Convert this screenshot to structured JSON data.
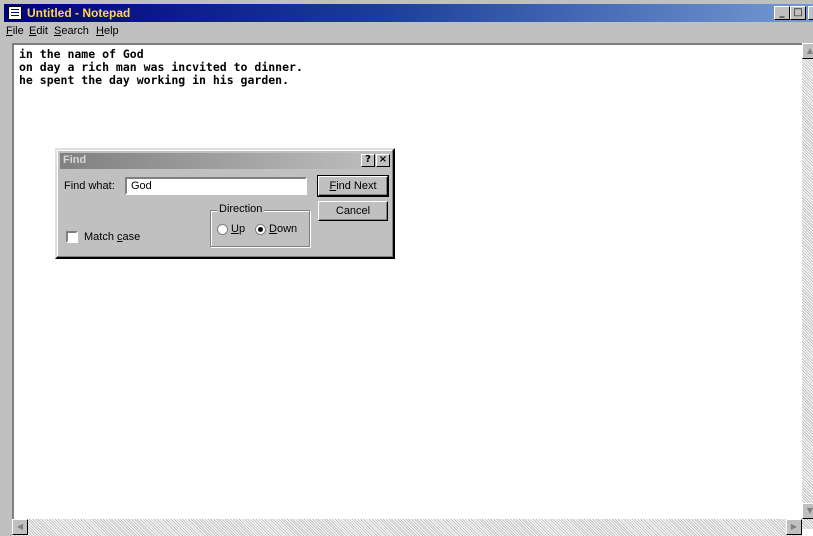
{
  "window": {
    "title": "Untitled - Notepad",
    "controls": {
      "minimize": "_",
      "maximize": "□",
      "close": "×"
    }
  },
  "menu": {
    "file": {
      "mnemonic": "F",
      "rest": "ile"
    },
    "edit": {
      "mnemonic": "E",
      "rest": "dit"
    },
    "search": {
      "mnemonic": "S",
      "rest": "earch"
    },
    "help": {
      "mnemonic": "H",
      "rest": "elp"
    }
  },
  "editor": {
    "text": "in the name of God\non day a rich man was incvited to dinner.\nhe spent the day working in his garden."
  },
  "find_dialog": {
    "title": "Find",
    "help_button": "?",
    "close_button": "×",
    "find_what_label": "Find what:",
    "find_what_value": "God",
    "find_next": {
      "mnemonic": "F",
      "rest": "ind Next"
    },
    "cancel_label": "Cancel",
    "direction_label": "Direction",
    "up": {
      "mnemonic": "U",
      "rest": "p"
    },
    "down": {
      "mnemonic": "D",
      "rest": "own"
    },
    "direction_selected": "down",
    "match_case": {
      "before": "Match ",
      "mnemonic": "c",
      "rest": "ase"
    },
    "match_case_checked": false
  },
  "colors": {
    "titlebar_start": "#000080",
    "titlebar_end": "#7a9fd4",
    "title_text": "#ffd84a",
    "chrome": "#c0c0c0"
  },
  "icons": {
    "app": "notepad-icon",
    "scroll_up": "arrow-up-icon",
    "scroll_down": "arrow-down-icon",
    "scroll_left": "arrow-left-icon",
    "scroll_right": "arrow-right-icon"
  }
}
